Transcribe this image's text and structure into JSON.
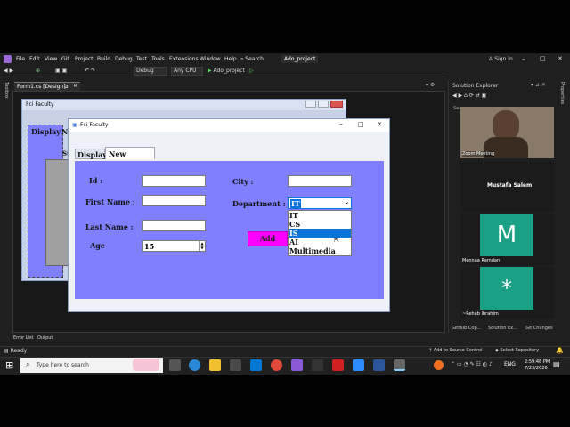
{
  "titlebar": {
    "project_name": "Ado_project",
    "signin": "Sign in"
  },
  "menu": [
    "File",
    "Edit",
    "View",
    "Git",
    "Project",
    "Build",
    "Debug",
    "Test",
    "Tools",
    "Extensions",
    "Window",
    "Help",
    "Search"
  ],
  "toolbar": {
    "config": "Debug",
    "platform": "Any CPU",
    "run_target": "Ado_project"
  },
  "left_rail": {
    "toolbox": "Toolbox"
  },
  "right_rail": {
    "properties": "Properties"
  },
  "doc_tab": {
    "label": "Form1.cs [Design]"
  },
  "designer_form": {
    "title": "Fci Faculty",
    "tab_display": "Display",
    "tab_partial": "N",
    "s_partial": "St"
  },
  "app_window": {
    "title": "Fci Faculty",
    "tabs": [
      "Display",
      "New Student"
    ],
    "labels": {
      "id": "Id :",
      "first_name": "First Name :",
      "last_name": "Last Name :",
      "age": "Age",
      "city": "City :",
      "department": "Department :"
    },
    "fields": {
      "id": "",
      "first_name": "",
      "last_name": "",
      "age": "15",
      "city": "",
      "department": "IT"
    },
    "department_options": [
      "IT",
      "CS",
      "IS",
      "AI",
      "Multimedia"
    ],
    "highlighted_option": "IS",
    "add_button": "Add"
  },
  "solution_explorer": {
    "title": "Solution Explorer",
    "search_partial": "Sea"
  },
  "meeting": {
    "tiles": [
      {
        "name": "Zoom Meeting"
      },
      {
        "name": "Mustafa Salem"
      },
      {
        "name": "Mennaa Ramdan",
        "initial": "M"
      },
      {
        "name": "~Rehab Ibrahim",
        "initial": "*"
      }
    ]
  },
  "bottom_tabs": [
    "Error List",
    "Output"
  ],
  "right_bottom_tabs": [
    "GitHub Cop...",
    "Solution Ex...",
    "Git Changes"
  ],
  "status": {
    "ready": "Ready",
    "add_source": "Add to Source Control",
    "select_repo": "Select Repository"
  },
  "taskbar": {
    "search_placeholder": "Type here to search",
    "lang": "ENG",
    "time": "2:59:48 PM",
    "date": "7/23/2026"
  },
  "colors": {
    "panel": "#8080ff",
    "add_button": "#ff00ff",
    "tile_green": "#1aa185",
    "highlight": "#0a74d8"
  }
}
